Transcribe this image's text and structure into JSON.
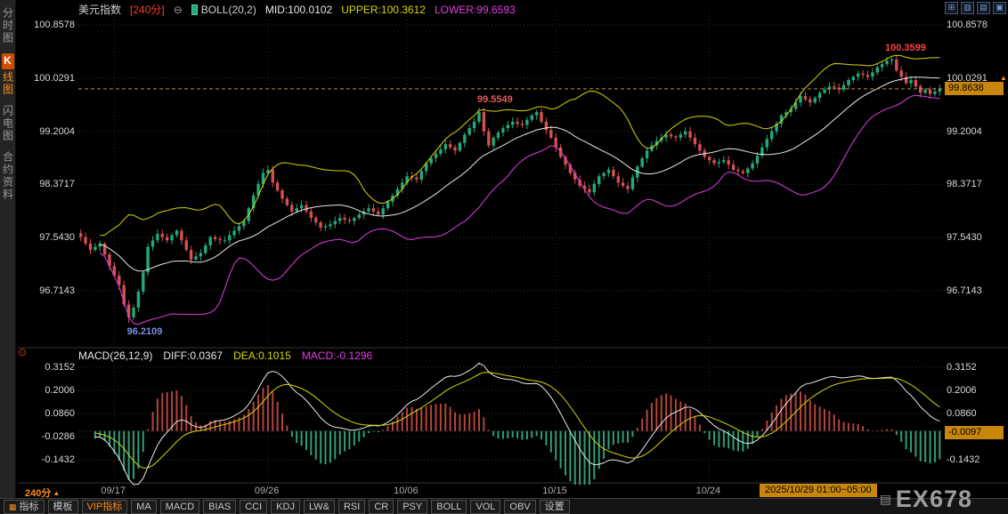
{
  "header": {
    "symbol": "美元指数",
    "period": "[240分]",
    "collapse_icon": "⊖",
    "indicator_label": "BOLL(20,2)",
    "mid_label": "MID:100.0102",
    "upper_label": "UPPER:100.3612",
    "lower_label": "LOWER:99.6593"
  },
  "window_controls": [
    {
      "key": "layout-grid-icon",
      "glyph": "⊞"
    },
    {
      "key": "layout-vertical-split-icon",
      "glyph": "▥"
    },
    {
      "key": "layout-horizontal-split-icon",
      "glyph": "▤"
    },
    {
      "key": "layout-single-pane-icon",
      "glyph": "▣"
    }
  ],
  "sidebar": {
    "items": [
      {
        "key": "time-chart",
        "label": "分时图",
        "active": false
      },
      {
        "key": "kline-chart",
        "label": "K线图",
        "active": true
      },
      {
        "key": "lightning-chart",
        "label": "闪电图",
        "active": false
      },
      {
        "key": "contract-info",
        "label": "合约资料",
        "active": false
      }
    ]
  },
  "macd_header": {
    "label": "MACD(26,12,9)",
    "diff_label": "DIFF:0.0367",
    "dea_label": "DEA:0.1015",
    "macd_label": "MACD:-0.1296"
  },
  "price_box": {
    "value": "99.8638",
    "arrow": "▲"
  },
  "macd_box": {
    "value": "-0.0097"
  },
  "period_selector": {
    "label": "240分",
    "arrow": "▲"
  },
  "indicator_dot_icon": "⊙",
  "watermark": {
    "text": "EX678",
    "logo_glyph": "▤"
  },
  "toolbar": {
    "items": [
      {
        "key": "indicator",
        "label": "指标",
        "icon": true
      },
      {
        "key": "template",
        "label": "模板"
      },
      {
        "key": "vip-indicator",
        "label": "VIP指标",
        "accent": true
      },
      {
        "key": "ma",
        "label": "MA"
      },
      {
        "key": "macd",
        "label": "MACD"
      },
      {
        "key": "bias",
        "label": "BIAS"
      },
      {
        "key": "cci",
        "label": "CCI"
      },
      {
        "key": "kdj",
        "label": "KDJ"
      },
      {
        "key": "lw",
        "label": "LW&"
      },
      {
        "key": "rsi",
        "label": "RSI"
      },
      {
        "key": "cr",
        "label": "CR"
      },
      {
        "key": "psy",
        "label": "PSY"
      },
      {
        "key": "boll",
        "label": "BOLL"
      },
      {
        "key": "vol",
        "label": "VOL"
      },
      {
        "key": "obv",
        "label": "OBV"
      },
      {
        "key": "settings",
        "label": "设置"
      }
    ]
  },
  "chart_data": {
    "type": "candlestick",
    "title": "美元指数 240分钟K线, BOLL(20,2) 与 MACD(26,12,9)",
    "period": "240分",
    "last_price": 99.8638,
    "ylim": [
      95.95,
      101.05
    ],
    "price_axis": {
      "ticks": [
        "100.8578",
        "100.0291",
        "99.2004",
        "98.3717",
        "97.5430",
        "96.7143"
      ]
    },
    "date_labels": [
      {
        "text": "09/17",
        "index": 7
      },
      {
        "text": "09/26",
        "index": 39
      },
      {
        "text": "10/06",
        "index": 68
      },
      {
        "text": "10/15",
        "index": 99
      },
      {
        "text": "10/24",
        "index": 131
      }
    ],
    "current_bar_label": "2025/10/29 01:00~05:00",
    "annotations": [
      {
        "text": "100.3599",
        "index": 168,
        "value": 100.3599,
        "side": "above",
        "color": "#ff4242"
      },
      {
        "text": "99.5549",
        "index": 83,
        "value": 99.5549,
        "side": "above",
        "color": "#e05b5b"
      },
      {
        "text": "96.2109",
        "index": 10,
        "value": 96.2109,
        "side": "below",
        "color": "#7b8fe6"
      }
    ],
    "closes": [
      97.55,
      97.45,
      97.35,
      97.4,
      97.45,
      97.28,
      97.1,
      96.95,
      96.8,
      96.5,
      96.3,
      96.45,
      96.7,
      97.0,
      97.4,
      97.5,
      97.6,
      97.55,
      97.5,
      97.58,
      97.65,
      97.5,
      97.35,
      97.2,
      97.25,
      97.3,
      97.42,
      97.55,
      97.52,
      97.5,
      97.5,
      97.58,
      97.65,
      97.72,
      97.8,
      98.0,
      98.2,
      98.38,
      98.55,
      98.6,
      98.4,
      98.28,
      98.15,
      98.05,
      97.95,
      98.0,
      98.05,
      97.95,
      97.85,
      97.78,
      97.7,
      97.72,
      97.75,
      97.8,
      97.85,
      97.82,
      97.8,
      97.85,
      97.9,
      97.95,
      98.0,
      97.95,
      97.9,
      98.0,
      98.1,
      98.2,
      98.3,
      98.4,
      98.5,
      98.48,
      98.45,
      98.58,
      98.7,
      98.78,
      98.85,
      98.92,
      99.0,
      98.95,
      98.9,
      99.02,
      99.15,
      99.25,
      99.35,
      99.5,
      99.2,
      98.98,
      99.1,
      99.18,
      99.25,
      99.3,
      99.35,
      99.32,
      99.3,
      99.38,
      99.45,
      99.5,
      99.35,
      99.22,
      99.1,
      98.95,
      98.8,
      98.68,
      98.55,
      98.45,
      98.35,
      98.3,
      98.25,
      98.38,
      98.5,
      98.55,
      98.6,
      98.5,
      98.4,
      98.35,
      98.3,
      98.48,
      98.65,
      98.78,
      98.9,
      98.98,
      99.05,
      99.1,
      99.15,
      99.12,
      99.1,
      99.15,
      99.2,
      99.1,
      99.0,
      98.9,
      98.8,
      98.75,
      98.7,
      98.72,
      98.75,
      98.68,
      98.6,
      98.58,
      98.55,
      98.62,
      98.7,
      98.82,
      98.95,
      99.08,
      99.2,
      99.32,
      99.45,
      99.5,
      99.55,
      99.65,
      99.75,
      99.7,
      99.65,
      99.72,
      99.8,
      99.85,
      99.9,
      99.88,
      99.85,
      99.92,
      100.0,
      100.05,
      100.1,
      100.08,
      100.05,
      100.12,
      100.2,
      100.25,
      100.3,
      100.32,
      100.15,
      100.05,
      99.95,
      100.0,
      99.9,
      99.8,
      99.85,
      99.78,
      99.82,
      99.86
    ],
    "boll": {
      "period": 20,
      "width": 2
    },
    "macd": {
      "fast": 12,
      "slow": 26,
      "signal": 9,
      "ylim": [
        -0.27,
        0.38
      ],
      "axis_ticks": [
        "0.3152",
        "0.2006",
        "0.0860",
        "-0.0286",
        "-0.1432"
      ]
    },
    "colors": {
      "up": "#23a97c",
      "down": "#d84f4f",
      "boll_upper": "#d6d600",
      "boll_mid": "#e8e8e8",
      "boll_lower": "#e23de2",
      "macd_diff": "#e8e8e8",
      "macd_dea": "#d6d600",
      "hist_pos": "#b4443c",
      "hist_neg": "#2f9e78",
      "last_price_line": "#c89030",
      "accent_orange": "#c8870b",
      "grid": "#2c2c2c"
    }
  }
}
